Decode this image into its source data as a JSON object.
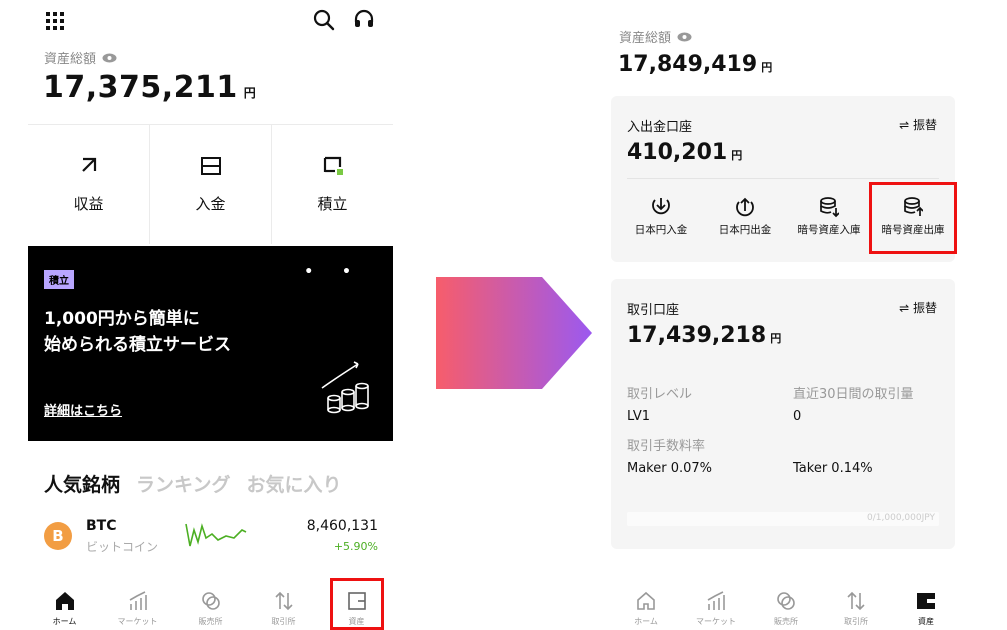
{
  "left": {
    "asset_label": "資産総額",
    "asset_value": "17,375,211",
    "asset_unit": "円",
    "actions": [
      "収益",
      "入金",
      "積立"
    ],
    "banner": {
      "tag": "積立",
      "dots": "• •",
      "headline_line1": "1,000円から簡単に",
      "headline_line2": "始められる積立サービス",
      "link": "詳細はこちら"
    },
    "tabs": [
      "人気銘柄",
      "ランキング",
      "お気に入り"
    ],
    "coin": {
      "logo": "B",
      "symbol": "BTC",
      "name": "ビットコイン",
      "price": "8,460,131",
      "change": "+5.90%"
    },
    "nav": [
      "ホーム",
      "マーケット",
      "販売所",
      "取引所",
      "資産"
    ]
  },
  "right": {
    "asset_label": "資産総額",
    "asset_value": "17,849,419",
    "asset_unit": "円",
    "deposit_account": {
      "title": "入出金口座",
      "transfer": "⇌ 振替",
      "value": "410,201",
      "unit": "円",
      "actions": [
        "日本円入金",
        "日本円出金",
        "暗号資産入庫",
        "暗号資産出庫"
      ]
    },
    "trade_account": {
      "title": "取引口座",
      "transfer": "⇌ 振替",
      "value": "17,439,218",
      "unit": "円",
      "level_label": "取引レベル",
      "level_value": "LV1",
      "volume_label": "直近30日間の取引量",
      "volume_value": "0",
      "fee_label": "取引手数料率",
      "maker_fee": "Maker 0.07%",
      "taker_fee": "Taker 0.14%",
      "progress_text": "0/1,000,000JPY",
      "progress_fraction": 0
    },
    "nav": [
      "ホーム",
      "マーケット",
      "販売所",
      "取引所",
      "資産"
    ]
  },
  "colors": {
    "highlight": "#e11111",
    "arrow_start": "#f75d6b",
    "arrow_end": "#9b59f0",
    "btc": "#f29d43",
    "positive": "#4caf23",
    "banner_tag": "#b8a6ff"
  },
  "icons": {
    "top_left": [
      "grid-menu-icon",
      "search-icon",
      "headset-icon"
    ],
    "actions_left": [
      "arrow-up-right-icon",
      "wallet-icon",
      "stack-plus-icon"
    ],
    "actions_right": [
      "download-icon",
      "upload-icon",
      "coin-stack-in-icon",
      "coin-stack-out-icon"
    ],
    "nav": [
      "home-icon",
      "chart-icon",
      "circles-icon",
      "swap-arrows-icon",
      "asset-wallet-icon"
    ]
  }
}
